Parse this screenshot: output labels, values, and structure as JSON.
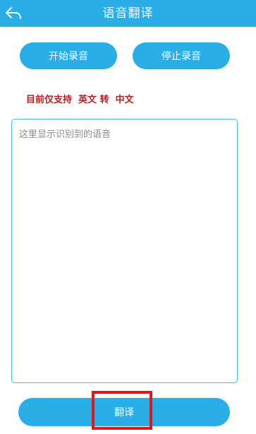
{
  "header": {
    "title": "语音翻译",
    "back_icon": "back-arrow-icon"
  },
  "controls": {
    "start_label": "开始录音",
    "stop_label": "停止录音"
  },
  "notice": {
    "text": "目前仅支持  英文 转  中文"
  },
  "recognition": {
    "value": "",
    "placeholder": "这里显示识别到的语音"
  },
  "actions": {
    "translate_label": "翻译"
  },
  "colors": {
    "accent": "#2aaee8",
    "notice": "#b81d1d",
    "highlight": "#e3161d"
  }
}
